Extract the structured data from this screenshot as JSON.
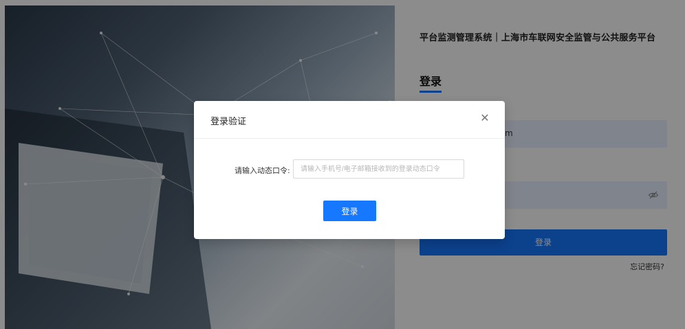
{
  "header": {
    "system_title": "平台监测管理系统｜上海市车联网安全监管与公共服务平台"
  },
  "login": {
    "heading": "登录",
    "username_value": "m",
    "submit_label": "登录",
    "forgot_label": "忘记密码?"
  },
  "modal": {
    "title": "登录验证",
    "close_icon": "close-icon",
    "otp_label": "请输入动态口令:",
    "otp_placeholder": "请输入手机号/电子邮箱接收到的登录动态口令",
    "submit_label": "登录"
  },
  "icons": {
    "password_toggle": "eye-off-icon"
  },
  "colors": {
    "primary": "#1677ff",
    "input_bg": "#e9f0ff",
    "mask": "rgba(0,0,0,0.45)"
  }
}
